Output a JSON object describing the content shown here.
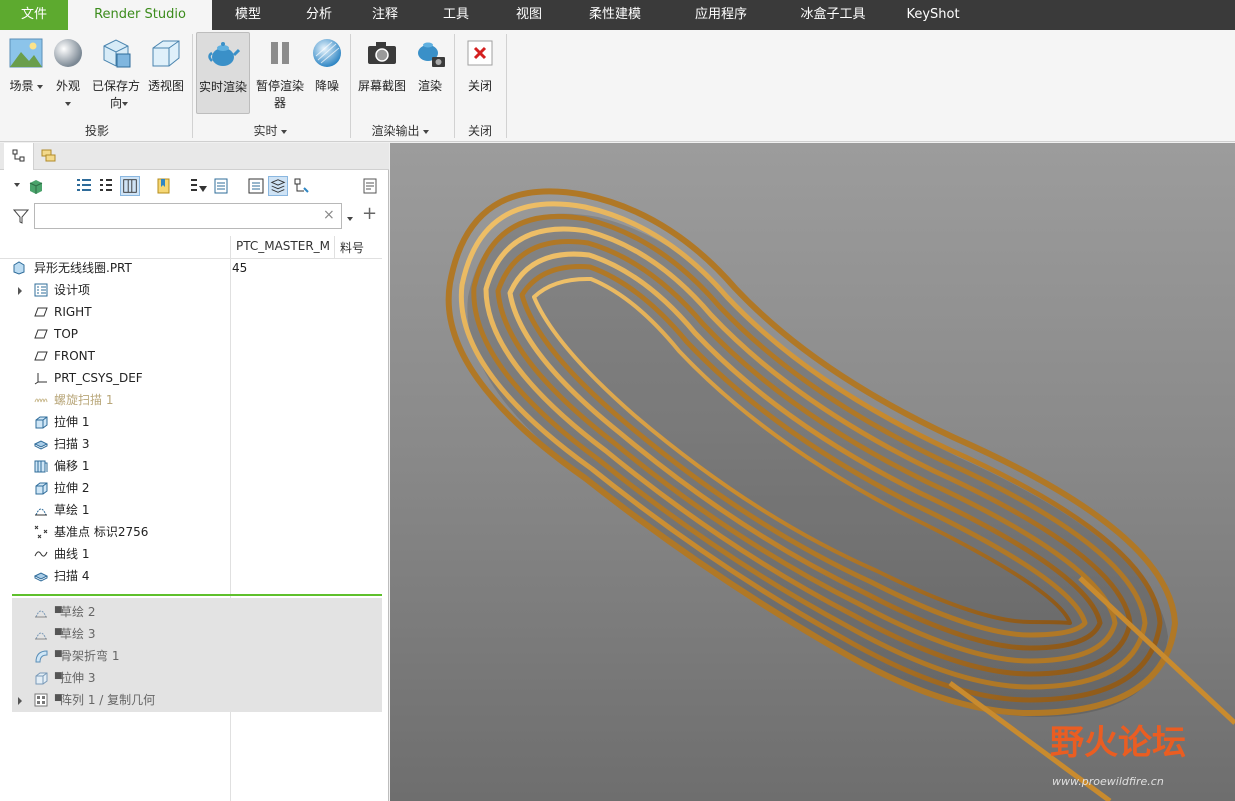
{
  "tabs": [
    "文件",
    "Render Studio",
    "模型",
    "分析",
    "注释",
    "工具",
    "视图",
    "柔性建模",
    "应用程序",
    "冰盒子工具",
    "KeyShot"
  ],
  "ribbon": {
    "scene": "场景",
    "appearance": "外观",
    "saved_orient": "已保存方向",
    "perspective": "透视图",
    "realtime_render": "实时渲染",
    "pause_render": "暂停渲染器",
    "denoise": "降噪",
    "screenshot": "屏幕截图",
    "render": "渲染",
    "close": "关闭",
    "group_projection": "投影",
    "group_realtime": "实时",
    "group_output": "渲染输出",
    "group_close": "关闭"
  },
  "tree": {
    "filter_value": "",
    "columns": [
      "PTC_MASTER_M",
      "料号"
    ],
    "root": {
      "label": "异形无线线圈.PRT",
      "value": "45"
    },
    "items": [
      {
        "label": "设计项"
      },
      {
        "label": "RIGHT"
      },
      {
        "label": "TOP"
      },
      {
        "label": "FRONT"
      },
      {
        "label": "PRT_CSYS_DEF"
      },
      {
        "label": "螺旋扫描 1"
      },
      {
        "label": "拉伸 1"
      },
      {
        "label": "扫描 3"
      },
      {
        "label": "偏移 1"
      },
      {
        "label": "拉伸 2"
      },
      {
        "label": "草绘 1"
      },
      {
        "label": "基准点 标识2756"
      },
      {
        "label": "曲线 1"
      },
      {
        "label": "扫描 4"
      }
    ],
    "suppressed": [
      {
        "label": "草绘 2"
      },
      {
        "label": "草绘 3"
      },
      {
        "label": "骨架折弯 1"
      },
      {
        "label": "拉伸 3"
      },
      {
        "label": "阵列 1 / 复制几何"
      }
    ]
  },
  "watermark": {
    "title": "野火论坛",
    "url": "www.proewildfire.cn"
  },
  "colors": {
    "file_tab": "#5daa2f",
    "active_tab_text": "#3c8c1c",
    "copper": "#d9a046",
    "insert_line": "#5fc02c"
  }
}
